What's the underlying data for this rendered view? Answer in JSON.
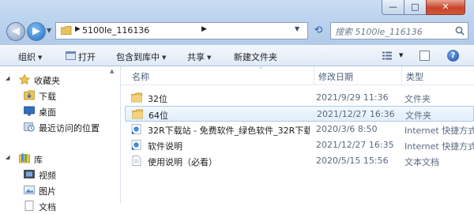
{
  "window": {
    "min_label": "—",
    "max_label": "□",
    "close_label": "✕"
  },
  "address": {
    "path": "5100le_116136",
    "search_placeholder": "搜索 5100le_116136"
  },
  "toolbar": {
    "organize": "组织",
    "open": "打开",
    "include_in_library": "包含到库中",
    "share": "共享",
    "new_folder": "新建文件夹",
    "help": "?"
  },
  "nav": {
    "favorites": "收藏夹",
    "downloads": "下载",
    "desktop": "桌面",
    "recent": "最近访问的位置",
    "library": "库",
    "videos": "视频",
    "pictures": "图片",
    "documents": "文档"
  },
  "columns": {
    "name": "名称",
    "modified": "修改日期",
    "type": "类型"
  },
  "files": [
    {
      "name": "32位",
      "date": "2021/9/29 11:36",
      "type": "文件夹",
      "icon": "folder-icon"
    },
    {
      "name": "64位",
      "date": "2021/12/27 16:36",
      "type": "文件夹",
      "icon": "folder-icon"
    },
    {
      "name": "32R下载站 - 免费软件_绿色软件_32R下载站",
      "date": "2020/3/6 8:50",
      "type": "Internet 快捷方式",
      "icon": "internet-shortcut-icon"
    },
    {
      "name": "软件说明",
      "date": "2021/12/27 16:35",
      "type": "Internet 快捷方式",
      "icon": "internet-shortcut-icon"
    },
    {
      "name": "使用说明（必看）",
      "date": "2020/5/15 15:56",
      "type": "文本文档",
      "icon": "text-document-icon"
    }
  ],
  "colors": {
    "accent": "#1f6fc4",
    "selection": "#e2eefb",
    "folder": "#e8c35c"
  }
}
